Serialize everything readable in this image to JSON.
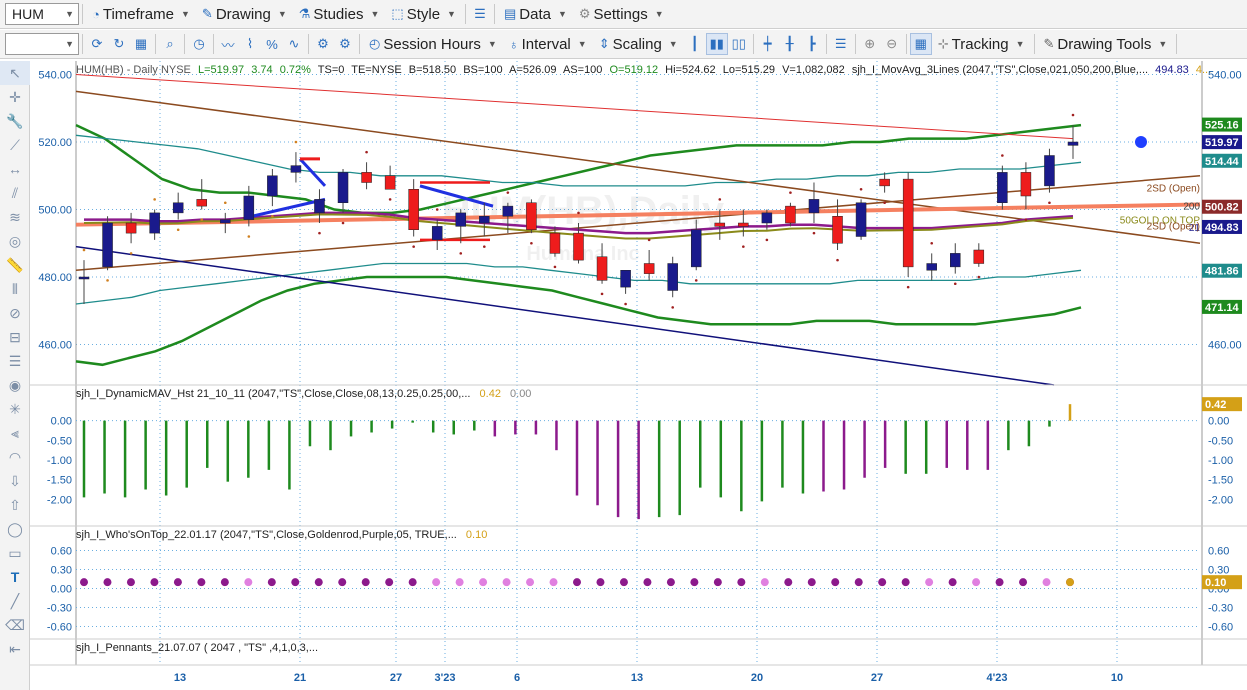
{
  "toolbar1": {
    "symbol": "HUM",
    "timeframe": "Timeframe",
    "drawing": "Drawing",
    "studies": "Studies",
    "style": "Style",
    "data": "Data",
    "settings": "Settings"
  },
  "toolbar2": {
    "session_hours": "Session Hours",
    "interval": "Interval",
    "scaling": "Scaling",
    "tracking": "Tracking",
    "drawing_tools": "Drawing Tools"
  },
  "colors": {
    "up": "#1a1a8c",
    "down": "#ee1c1c",
    "green_band": "#1e8a1e",
    "teal_band": "#1f8c8c",
    "brown": "#8b4a1f",
    "navy": "#10107a",
    "salmon": "#f58060",
    "purple": "#8c1a8c",
    "olive": "#8a8a1a",
    "goldenrod": "#d4a017",
    "pink": "#e080e0"
  },
  "header": {
    "symbol": "HUM(HB) - Daily  NYSE",
    "last": "L=519.97",
    "chg": "3.74",
    "pct": "0.72%",
    "ts": "TS=0",
    "te": "TE=NYSE",
    "bid": "B=518.50",
    "bs": "BS=100",
    "ask": "A=526.09",
    "as": "AS=100",
    "open": "O=519.12",
    "hi": "Hi=524.62",
    "lo": "Lo=515.29",
    "vol": "V=1,082,082",
    "study": "sjh_I_MovAvg_3Lines (2047,\"TS\",Close,021,050,200,Blue,...",
    "study_val1": "494.83",
    "study_val2": "4..."
  },
  "watermark": {
    "title": "HUM(HB),Daily",
    "sub": "Humana Inc"
  },
  "price_axis": {
    "left_labels": [
      "540.00",
      "520.00",
      "500.00",
      "480.00",
      "460.00"
    ],
    "right_labels": [
      "540.00",
      "460.00"
    ],
    "badges": [
      {
        "text": "525.16",
        "bg": "#1e8a1e",
        "y": 525.16
      },
      {
        "text": "519.97",
        "bg": "#1a1a8c",
        "y": 519.97
      },
      {
        "text": "514.44",
        "bg": "#1f8c8c",
        "y": 514.44
      },
      {
        "text": "500.82",
        "bg": "#8b2a2a",
        "y": 500.82
      },
      {
        "text": "494.83",
        "bg": "#1a1a8c",
        "y": 494.83
      },
      {
        "text": "481.86",
        "bg": "#1f8c8c",
        "y": 481.86
      },
      {
        "text": "471.14",
        "bg": "#1e8a1e",
        "y": 471.14
      }
    ],
    "annotations": [
      {
        "text": "2SD (Open)",
        "y": 506.5,
        "color": "#8b4a1f"
      },
      {
        "text": "200",
        "y": 501.2,
        "color": "#444"
      },
      {
        "text": "50GOLD ON TOP",
        "y": 497.0,
        "color": "#8a8a1a"
      },
      {
        "text": "21",
        "y": 494.8,
        "color": "#1a1a8c"
      },
      {
        "text": "2SD (Open)",
        "y": 495.3,
        "color": "#8b4a1f"
      }
    ]
  },
  "chart_data": {
    "type": "candlestick",
    "x_labels": [
      "13",
      "21",
      "27",
      "3'23",
      "6",
      "13",
      "20",
      "27",
      "4'23",
      "10"
    ],
    "price_range": [
      448,
      544
    ],
    "candles": [
      {
        "o": 480,
        "h": 485,
        "l": 472,
        "c": 480
      },
      {
        "o": 483,
        "h": 498,
        "l": 482,
        "c": 496
      },
      {
        "o": 496,
        "h": 499,
        "l": 490,
        "c": 493
      },
      {
        "o": 493,
        "h": 500,
        "l": 491,
        "c": 499
      },
      {
        "o": 499,
        "h": 505,
        "l": 497,
        "c": 502
      },
      {
        "o": 503,
        "h": 509,
        "l": 500,
        "c": 501
      },
      {
        "o": 496,
        "h": 499,
        "l": 493,
        "c": 497
      },
      {
        "o": 497,
        "h": 507,
        "l": 495,
        "c": 504
      },
      {
        "o": 504,
        "h": 512,
        "l": 501,
        "c": 510
      },
      {
        "o": 511,
        "h": 517,
        "l": 508,
        "c": 513
      },
      {
        "o": 499,
        "h": 506,
        "l": 496,
        "c": 503
      },
      {
        "o": 502,
        "h": 512,
        "l": 499,
        "c": 511
      },
      {
        "o": 511,
        "h": 514,
        "l": 506,
        "c": 508
      },
      {
        "o": 510,
        "h": 513,
        "l": 506,
        "c": 506
      },
      {
        "o": 506,
        "h": 509,
        "l": 492,
        "c": 494
      },
      {
        "o": 491,
        "h": 497,
        "l": 488,
        "c": 495
      },
      {
        "o": 495,
        "h": 500,
        "l": 490,
        "c": 499
      },
      {
        "o": 496,
        "h": 502,
        "l": 492,
        "c": 498
      },
      {
        "o": 498,
        "h": 502,
        "l": 493,
        "c": 501
      },
      {
        "o": 502,
        "h": 503,
        "l": 493,
        "c": 494
      },
      {
        "o": 493,
        "h": 495,
        "l": 486,
        "c": 487
      },
      {
        "o": 493,
        "h": 496,
        "l": 484,
        "c": 485
      },
      {
        "o": 486,
        "h": 490,
        "l": 478,
        "c": 479
      },
      {
        "o": 477,
        "h": 480,
        "l": 475,
        "c": 482
      },
      {
        "o": 484,
        "h": 488,
        "l": 479,
        "c": 481
      },
      {
        "o": 476,
        "h": 486,
        "l": 474,
        "c": 484
      },
      {
        "o": 483,
        "h": 497,
        "l": 482,
        "c": 494
      },
      {
        "o": 496,
        "h": 500,
        "l": 491,
        "c": 495
      },
      {
        "o": 496,
        "h": 500,
        "l": 492,
        "c": 495
      },
      {
        "o": 496,
        "h": 500,
        "l": 494,
        "c": 499
      },
      {
        "o": 501,
        "h": 502,
        "l": 495,
        "c": 496
      },
      {
        "o": 499,
        "h": 508,
        "l": 496,
        "c": 503
      },
      {
        "o": 498,
        "h": 503,
        "l": 488,
        "c": 490
      },
      {
        "o": 492,
        "h": 503,
        "l": 491,
        "c": 502
      },
      {
        "o": 509,
        "h": 511,
        "l": 505,
        "c": 507
      },
      {
        "o": 509,
        "h": 511,
        "l": 480,
        "c": 483
      },
      {
        "o": 482,
        "h": 487,
        "l": 479,
        "c": 484
      },
      {
        "o": 483,
        "h": 490,
        "l": 481,
        "c": 487
      },
      {
        "o": 488,
        "h": 490,
        "l": 483,
        "c": 484
      },
      {
        "o": 502,
        "h": 513,
        "l": 500,
        "c": 511
      },
      {
        "o": 511,
        "h": 514,
        "l": 500,
        "c": 504
      },
      {
        "o": 507,
        "h": 518,
        "l": 505,
        "c": 516
      },
      {
        "o": 519,
        "h": 525,
        "l": 515,
        "c": 520
      }
    ],
    "lines": {
      "green_upper": [
        525,
        521,
        515,
        509,
        506,
        505,
        505,
        504,
        503,
        500,
        499,
        499,
        500,
        502,
        504,
        506,
        508,
        510,
        512,
        514,
        516,
        517,
        518,
        519,
        519,
        519,
        519,
        520,
        520,
        521,
        521,
        521,
        522,
        523,
        524,
        525
      ],
      "green_lower": [
        455,
        454,
        456,
        458,
        461,
        465,
        469,
        473,
        476,
        478,
        479,
        480,
        480,
        480,
        480,
        479,
        478,
        477,
        476,
        474,
        472,
        470,
        468,
        467,
        466,
        466,
        466,
        466,
        467,
        467,
        467,
        466,
        466,
        466,
        466,
        467,
        468,
        469,
        471
      ],
      "teal_upper": [
        522,
        521,
        520,
        519,
        518,
        516,
        514,
        512,
        511,
        511,
        510,
        510,
        510,
        509,
        508,
        508,
        507,
        507,
        507,
        507,
        507,
        508,
        508,
        509,
        509,
        510,
        510,
        511,
        511,
        512,
        512,
        512,
        513,
        514
      ],
      "teal_lower": [
        472,
        473,
        474,
        476,
        477,
        478,
        479,
        480,
        481,
        482,
        483,
        484,
        484,
        484,
        484,
        483,
        483,
        482,
        481,
        480,
        479,
        479,
        478,
        478,
        478,
        478,
        478,
        478,
        479,
        479,
        479,
        479,
        479,
        480,
        480,
        481,
        482
      ]
    },
    "dynamic_mav": {
      "title": "sjh_I_DynamicMAV_Hst 21_10_11 (2047,\"TS\",Close,Close,08,13,0.25,0.25,00,...",
      "value1": "0.42",
      "value2": "0.00",
      "ticks": [
        "0.00",
        "-0.50",
        "-1.00",
        "-1.50",
        "-2.00"
      ],
      "right_badge": "0.42",
      "bars": [
        -1.95,
        -1.85,
        -1.95,
        -1.75,
        -1.9,
        -1.7,
        -1.2,
        -1.55,
        -1.45,
        -1.25,
        -1.75,
        -0.65,
        -0.75,
        -0.4,
        -0.3,
        -0.2,
        -0.05,
        -0.3,
        -0.35,
        -0.25,
        -0.4,
        -0.35,
        -0.35,
        -0.75,
        -1.9,
        -2.15,
        -2.45,
        -2.5,
        -2.45,
        -2.4,
        -1.7,
        -1.95,
        -2.3,
        -2.05,
        -1.7,
        -1.85,
        -1.8,
        -1.75,
        -1.45,
        -1.2,
        -1.35,
        -1.35,
        -1.2,
        -1.25,
        -1.25,
        -0.75,
        -0.65,
        -0.15,
        0.42
      ]
    },
    "whos_on_top": {
      "title": "sjh_I_Who'sOnTop_22.01.17 (2047,\"TS\",Close,Goldenrod,Purple,05, TRUE,...",
      "value": "0.10",
      "ticks": [
        "0.60",
        "0.30",
        "0.00",
        "-0.30",
        "-0.60"
      ],
      "right_badge": "0.10"
    },
    "pennants": {
      "title": "sjh_I_Pennants_21.07.07 ( 2047 , \"TS\" ,4,1,0,3,..."
    }
  }
}
